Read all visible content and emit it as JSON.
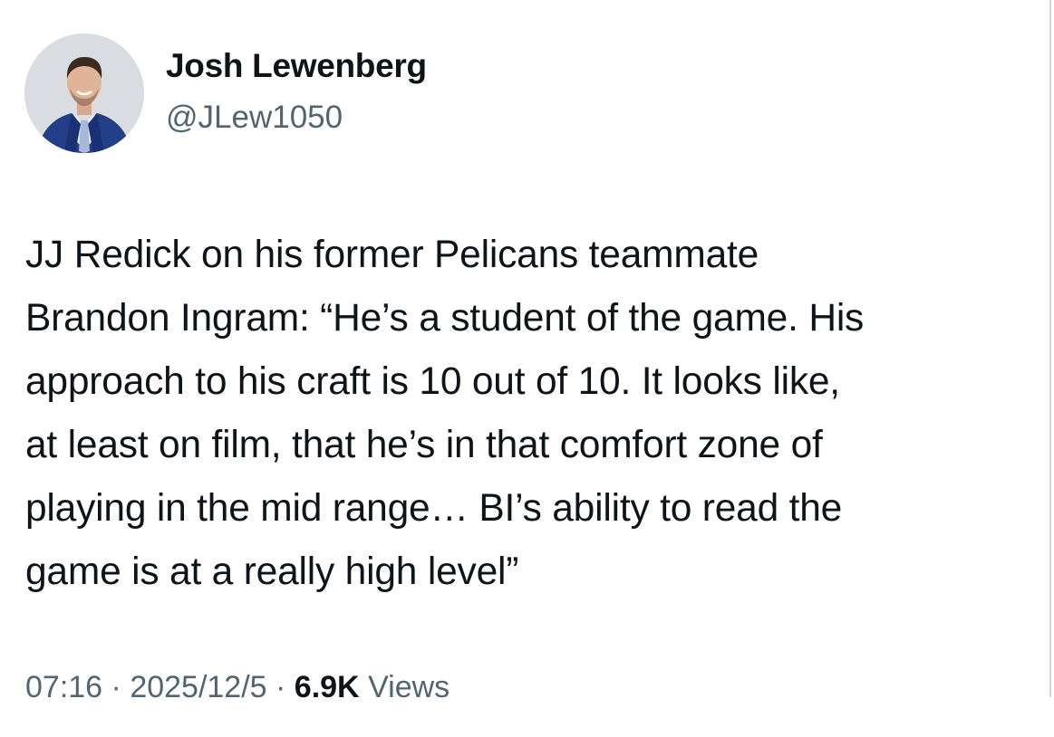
{
  "author": {
    "display_name": "Josh Lewenberg",
    "handle": "@JLew1050"
  },
  "tweet": {
    "lines": [
      "JJ Redick on his former Pelicans teammate",
      "Brandon Ingram: “He’s a student of the game. His",
      "approach to his craft is 10 out of 10. It looks like,",
      "at least on film, that he’s in that comfort zone of",
      "playing in the mid range… BI’s ability to read the",
      "game is at a really high level”"
    ]
  },
  "meta": {
    "time": "07:16",
    "separator": " · ",
    "date": "2025/12/5",
    "views_count": "6.9K",
    "views_label": " Views"
  },
  "colors": {
    "text": "#0f1419",
    "secondary": "#536471",
    "suit": "#1f3f86"
  },
  "icons": {
    "avatar": "profile-photo-man-in-blue-suit"
  }
}
